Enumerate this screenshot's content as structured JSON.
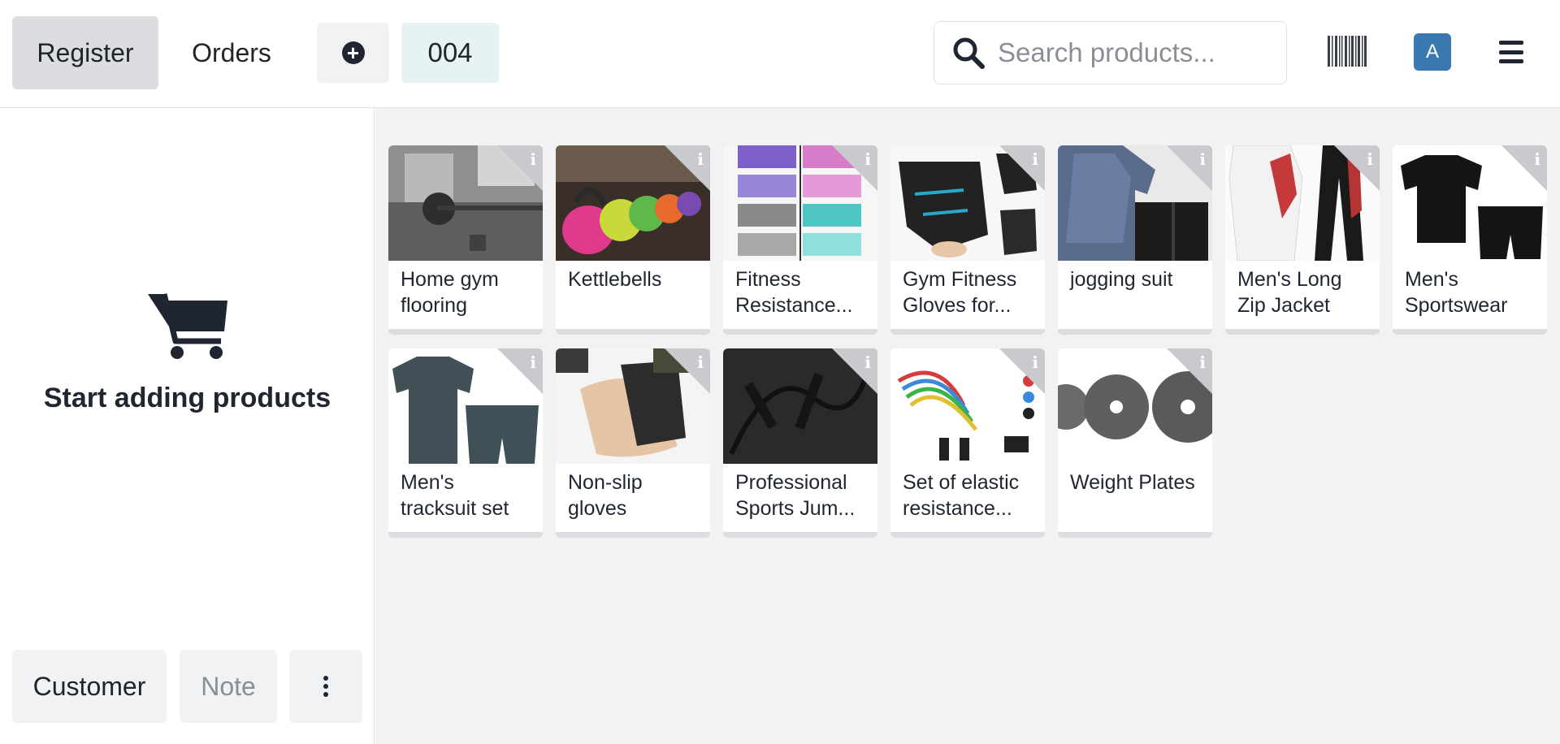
{
  "header": {
    "register_label": "Register",
    "orders_label": "Orders",
    "order_number": "004",
    "search_placeholder": "Search products...",
    "avatar_letter": "A"
  },
  "cart": {
    "empty_text": "Start adding products"
  },
  "actions": {
    "customer_label": "Customer",
    "note_label": "Note"
  },
  "products": [
    {
      "name": "Home gym flooring"
    },
    {
      "name": "Kettlebells"
    },
    {
      "name": "Fitness Resistance..."
    },
    {
      "name": "Gym Fitness Gloves for..."
    },
    {
      "name": "jogging suit"
    },
    {
      "name": "Men's Long Zip Jacket"
    },
    {
      "name": "Men's Sportswear"
    },
    {
      "name": "Men's tracksuit set"
    },
    {
      "name": "Non-slip gloves"
    },
    {
      "name": "Professional Sports Jum..."
    },
    {
      "name": "Set of elastic resistance..."
    },
    {
      "name": "Weight Plates"
    }
  ],
  "colors": {
    "accent": "#3a79b0",
    "dark": "#1f2531",
    "order_badge_bg": "#e6f2f4"
  }
}
